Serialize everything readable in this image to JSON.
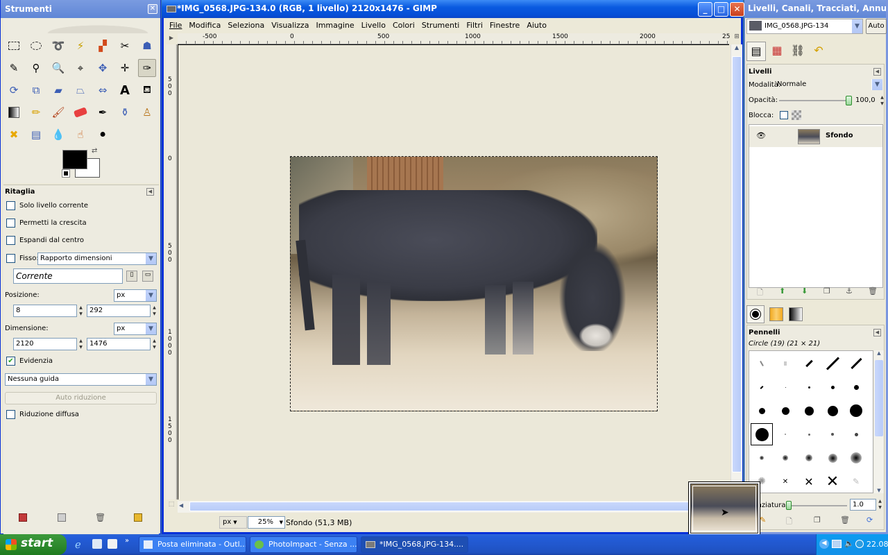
{
  "toolbox": {
    "title": "Strumenti",
    "close": "✕",
    "options_title": "Ritaglia",
    "opt_current_layer": "Solo livello corrente",
    "opt_allow_growing": "Permetti la crescita",
    "opt_expand_center": "Espandi dal centro",
    "opt_fixed": "Fisso:",
    "fixed_value": "Rapporto dimensioni",
    "current_value": "Corrente",
    "position_label": "Posizione:",
    "position_unit": "px",
    "position_x": "8",
    "position_y": "292",
    "size_label": "Dimensione:",
    "size_unit": "px",
    "size_w": "2120",
    "size_h": "1476",
    "highlight_label": "Evidenzia",
    "highlight_checked": "✔",
    "guides_value": "Nessuna guida",
    "auto_shrink": "Auto riduzione",
    "shrink_merged": "Riduzione diffusa"
  },
  "image_window": {
    "title": "*IMG_0568.JPG-134.0 (RGB, 1 livello) 2120x1476 - GIMP",
    "menu": [
      "File",
      "Modifica",
      "Seleziona",
      "Visualizza",
      "Immagine",
      "Livello",
      "Colori",
      "Strumenti",
      "Filtri",
      "Finestre",
      "Aiuto"
    ],
    "hruler": [
      "-500",
      "0",
      "500",
      "1000",
      "1500",
      "2000",
      "25"
    ],
    "vruler": [
      "500",
      "0",
      "500",
      "1000",
      "1500"
    ],
    "unit": "px",
    "zoom": "25%",
    "status": "Sfondo (51,3 MB)"
  },
  "layers": {
    "title": "Livelli, Canali, Tracciati, Annulla ...",
    "image_select": "IMG_0568.JPG-134",
    "auto_button": "Auto",
    "section": "Livelli",
    "mode_label": "Modalità:",
    "mode_value": "Normale",
    "opacity_label": "Opacità:",
    "opacity_value": "100,0",
    "opacity_fraction": 1.0,
    "lock_label": "Blocca:",
    "layer_name": "Sfondo"
  },
  "brushes": {
    "section": "Pennelli",
    "current": "Circle (19) (21 × 21)",
    "spacing_label": "Spaziatura:",
    "spacing_value": "1.0"
  },
  "taskbar": {
    "start": "start",
    "tasks": [
      "Posta eliminata - Outl...",
      "PhotoImpact - Senza ...",
      "*IMG_0568.JPG-134...."
    ],
    "clock": "22.08"
  },
  "colors": {
    "xp_blue": "#0a5ae0",
    "panel": "#edebe0",
    "canvas": "#ebe8d9"
  }
}
